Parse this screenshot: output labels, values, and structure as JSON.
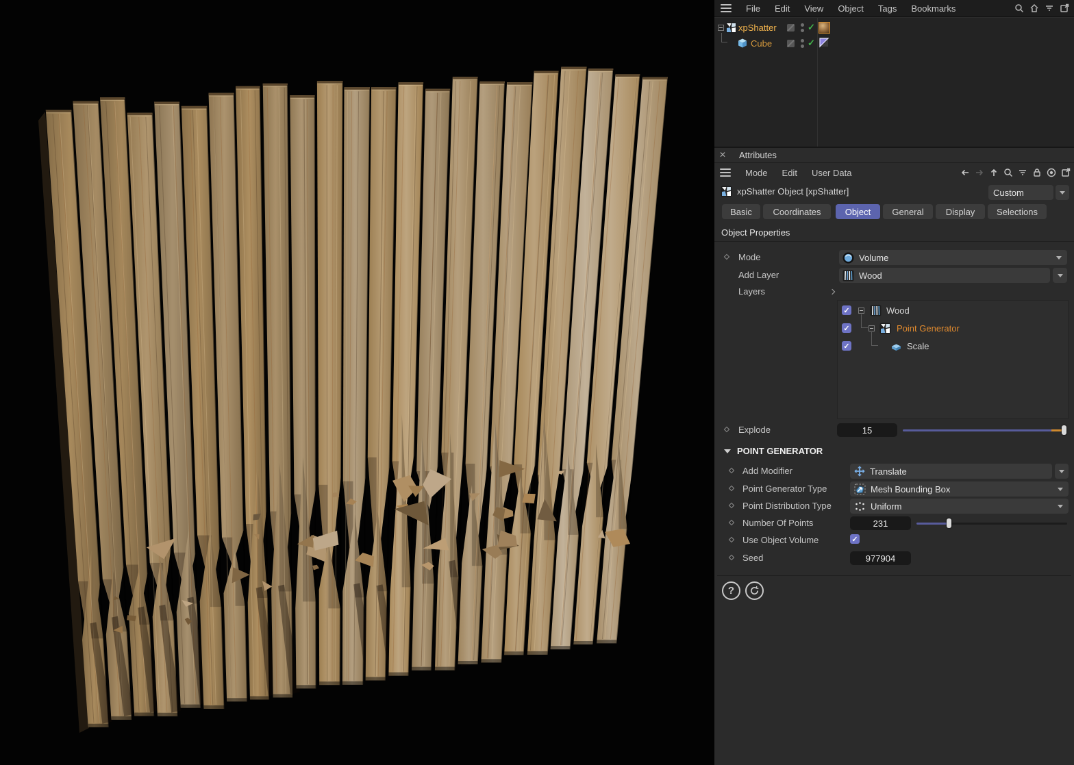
{
  "colors": {
    "accent_orange": "#e79a33",
    "selected_item_orange": "#f4b54d",
    "tab_active_blue": "#5c64ae",
    "check_green": "#43b14b",
    "checkbox_purple": "#6e73c5",
    "slider_track_purple": "#585c9c",
    "slider_end_orange": "#cf8a2e",
    "wood_base": "#b3a07a"
  },
  "glyphs": {
    "check": "✓",
    "help": "?"
  },
  "menu_bar": {
    "items": [
      {
        "label": "File"
      },
      {
        "label": "Edit"
      },
      {
        "label": "View"
      },
      {
        "label": "Object"
      },
      {
        "label": "Tags"
      },
      {
        "label": "Bookmarks"
      }
    ]
  },
  "object_manager": {
    "rows": [
      {
        "label": "xpShatter"
      },
      {
        "label": "Cube"
      }
    ]
  },
  "attributes": {
    "title": "Attributes",
    "menu": [
      {
        "label": "Mode"
      },
      {
        "label": "Edit"
      },
      {
        "label": "User Data"
      }
    ],
    "object_header": {
      "title": "xpShatter Object [xpShatter]",
      "preset": "Custom"
    },
    "tabs": [
      {
        "label": "Basic"
      },
      {
        "label": "Coordinates"
      },
      {
        "label": "Object",
        "active": true
      },
      {
        "label": "General"
      },
      {
        "label": "Display"
      },
      {
        "label": "Selections"
      }
    ],
    "object_properties": {
      "section_title": "Object Properties",
      "mode": {
        "label": "Mode",
        "value": "Volume"
      },
      "add_layer": {
        "label": "Add Layer",
        "value": "Wood"
      },
      "layers": {
        "label": "Layers",
        "tree": [
          {
            "label": "Wood",
            "checked": true
          },
          {
            "label": "Point Generator",
            "checked": true,
            "selected": true
          },
          {
            "label": "Scale",
            "checked": true
          }
        ]
      },
      "explode": {
        "label": "Explode",
        "value": "15",
        "slider_fraction": 0.985
      }
    },
    "point_generator": {
      "section_title": "POINT GENERATOR",
      "add_modifier": {
        "label": "Add Modifier",
        "value": "Translate"
      },
      "point_generator_type": {
        "label": "Point Generator Type",
        "value": "Mesh Bounding Box"
      },
      "point_distribution_type": {
        "label": "Point Distribution Type",
        "value": "Uniform"
      },
      "number_of_points": {
        "label": "Number Of Points",
        "value": "231",
        "slider_fraction": 0.22
      },
      "use_object_volume": {
        "label": "Use Object Volume",
        "checked": true
      },
      "seed": {
        "label": "Seed",
        "value": "977904"
      }
    }
  }
}
